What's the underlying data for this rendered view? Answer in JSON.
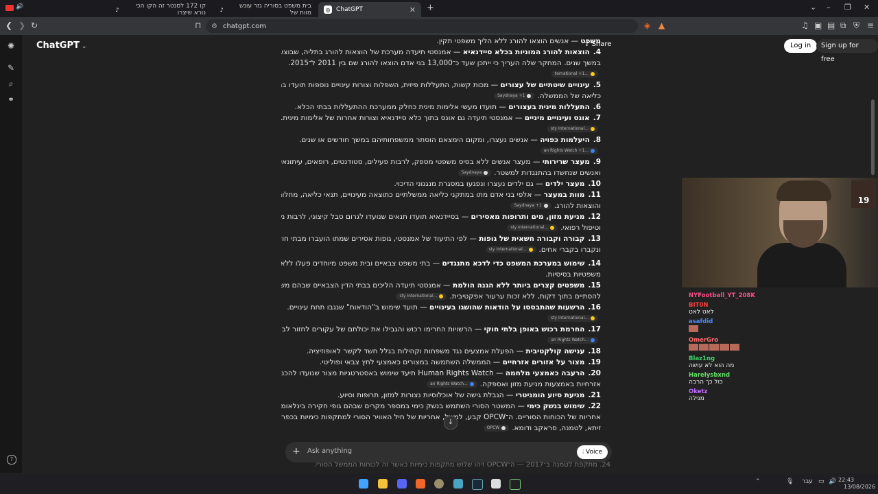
{
  "browser": {
    "tabs": [
      {
        "label": "קו 172 לסנטר זה הקו הכי נורא שיצרו",
        "favicon": "tiktok-icon"
      },
      {
        "label": "בית משפט בסוריה גזר עונש מוות של",
        "favicon": "tiktok-icon"
      },
      {
        "label": "ChatGPT",
        "favicon": "chatgpt-icon",
        "active": true
      }
    ],
    "url": "chatgpt.com"
  },
  "header": {
    "brand": "ChatGPT",
    "share": "Share",
    "login": "Log in",
    "signup": "Sign up for free"
  },
  "content": {
    "lines": [
      {
        "num": "",
        "bold": "משפט",
        "text": " — אנשים הוצאו להורג ללא הליך משפטי תקין.",
        "cite": ""
      },
      {
        "num": "4.",
        "bold": "הוצאות להורג המוניות בכלא סיידנאיא",
        "text": " — אמנסטי תיעדה מערכת של הוצאות להורג בתליה, שבוצעו בסתר",
        "cite": ""
      },
      {
        "num": "",
        "bold": "",
        "text": "במשך שנים. המחקר שלה העריך כי ייתכן שעד כ־13,000 בני אדם הוצאו להורג שם בין 2011 ל־2015.",
        "cite": ""
      },
      {
        "num": "",
        "bold": "",
        "text": "",
        "cite": "...ternational +1"
      },
      {
        "num": "5.",
        "bold": "עינויים שיטתיים של עצורים",
        "text": " — מכות קשות, התעללות פיזית, השפלות וצורות עינויים נוספות תועדו במתקני",
        "cite": ""
      },
      {
        "num": "",
        "bold": "",
        "text": "כליאה של הממשלה.",
        "cite": "Saydnaya +1"
      },
      {
        "num": "6.",
        "bold": "התעללות מינית בעצורים",
        "text": " — תועדו מעשי אלימות מינית כחלק ממערכת ההתעללות בבתי הכלא.",
        "cite": ""
      },
      {
        "num": "7.",
        "bold": "אונס ועינויים מיניים",
        "text": " — אמנסטי תיעדה גם אונס בתוך כלא סיידנאיא וצורות אחרות של אלימות מינית.",
        "cite": ""
      },
      {
        "num": "",
        "bold": "",
        "text": "",
        "cite": "...sty International"
      },
      {
        "num": "8.",
        "bold": "היעלמות כפויה",
        "text": " — אנשים נעצרו, ומקום הימצאם הוסתר ממשפחותיהם במשך חודשים או שנים.",
        "cite": ""
      },
      {
        "num": "",
        "bold": "",
        "text": "",
        "cite": "...an Rights Watch +1"
      },
      {
        "num": "9.",
        "bold": "מעצר שרירותי",
        "text": " — מעצר אנשים ללא בסיס משפטי מספק, לרבות פעילים, סטודנטים, רופאים, עיתונאים",
        "cite": ""
      },
      {
        "num": "",
        "bold": "",
        "text": "ואנשים שנחשדו בהתנגדות למשטר.",
        "cite": "Saydnaya"
      },
      {
        "num": "10.",
        "bold": "מעצר ילדים",
        "text": " — גם ילדים נעצרו ונפגעו במסגרת מנגנוני הדיכוי.",
        "cite": ""
      },
      {
        "num": "11.",
        "bold": "מוות במעצר",
        "text": " — אלפי בני אדם מתו במתקני כליאה ממשלתיים כתוצאה מעינויים, תנאי כליאה, מחלות, רעב",
        "cite": ""
      },
      {
        "num": "",
        "bold": "",
        "text": "והוצאות להורג.",
        "cite": "Saydnaya +1"
      },
      {
        "num": "12.",
        "bold": "מניעת מזון, מים ותרופות מאסירים",
        "text": " — בסיידנאיא תועדו תנאים שנועדו לגרום סבל קיצוני, לרבות מניעת מזון",
        "cite": ""
      },
      {
        "num": "",
        "bold": "",
        "text": "וטיפול רפואי.",
        "cite": "...sty International"
      },
      {
        "num": "13.",
        "bold": "קבורה וקבורה חשאית של גופות",
        "text": " — לפי התיעוד של אמנסטי, גופות אסירים שמתו הועברו מבתי חולים צבאיים",
        "cite": ""
      },
      {
        "num": "",
        "bold": "",
        "text": "ונקברו בקברי אחים.",
        "cite": "...sty International"
      },
      {
        "num": "14.",
        "bold": "שימוש במערכת המשפט כדי לדכא מתנגדים",
        "text": " — בתי משפט צבאיים ובית משפט מיוחדים פעלו ללא ערבויות",
        "cite": ""
      },
      {
        "num": "",
        "bold": "",
        "text": "משפטיות בסיסיות.",
        "cite": ""
      },
      {
        "num": "15.",
        "bold": "משפטים קצרים ביותר ללא הגנה הולמת",
        "text": " — אמנסטי תיעדה הליכים בבתי הדין הצבאיים שבהם משפטים יכלו",
        "cite": ""
      },
      {
        "num": "",
        "bold": "",
        "text": "להסתיים בתוך דקות, ללא זכות ערעור אפקטיבית.",
        "cite": "...sty International"
      },
      {
        "num": "16.",
        "bold": "הרשעות שהתבססו על הודאות שהושגו בעינויים",
        "text": " — תועד שימוש ב\"הודאות\" שנגבו תחת עינויים.",
        "cite": ""
      },
      {
        "num": "",
        "bold": "",
        "text": "",
        "cite": "...sty International"
      },
      {
        "num": "17.",
        "bold": "החרמת רכוש באופן בלתי חוקי",
        "text": " — הרשויות החרימו רכוש והגבילו את יכולתם של עקורים לחזור לבתיהם.",
        "cite": ""
      },
      {
        "num": "",
        "bold": "",
        "text": "",
        "cite": "...an Rights Watch"
      },
      {
        "num": "18.",
        "bold": "ענישה קולקטיבית",
        "text": " — הפעלת אמצעים נגד משפחות וקהילות בגלל חשד לקשר לאופוזיציה.",
        "cite": ""
      },
      {
        "num": "19.",
        "bold": "מצור על אזורים אזרחיים",
        "text": " — הממשלה השתמשה במצורים כאמצעי לחץ צבאי ופוליטי.",
        "cite": ""
      },
      {
        "num": "20.",
        "bold": "הרעבה כאמצעי מלחמה",
        "text": " — Human Rights Watch תיעד שימוש באסטרטגיות מצור שנועדו להכניע אוכלוסיות",
        "cite": ""
      },
      {
        "num": "",
        "bold": "",
        "text": "אזרחיות באמצעות מניעת מזון ואספקה.",
        "cite": "...an Rights Watch"
      },
      {
        "num": "21.",
        "bold": "מניעת סיוע הומניטרי",
        "text": " — הגבלת גישה של אוכלוסיות נצורות למזון, תרופות וסיוע.",
        "cite": ""
      },
      {
        "num": "22.",
        "bold": "שימוש בנשק כימי",
        "text": " — המשטר הסורי השתמש בנשק כימי במספר מקרים שבהם גופי חקירה בינלאומיים קבעו",
        "cite": ""
      },
      {
        "num": "",
        "bold": "",
        "text": "אחריות של הכוחות הסוריים. ה־OPCW קבע, למשל, אחריות של חיל האוויר הסורי למתקפות כימיות בכפר",
        "cite": ""
      },
      {
        "num": "",
        "bold": "",
        "text": "זיתא, לטמנה, סראקב ודומא.",
        "cite": "OPCW"
      }
    ],
    "under_composer": "24. מתקפת לטמנה ב־2017 — ה־OPCW זיהו שלוש מתקפות כימיות כאשר זה לכוחות הממשל הסורי."
  },
  "composer": {
    "placeholder": "Ask anything",
    "voice": "Voice"
  },
  "stream": {
    "badge": "19",
    "chat": [
      {
        "user": "NYFootball_YT_208K",
        "color": "#ff4f8a",
        "text": ""
      },
      {
        "user": "BIT0N",
        "color": "#ff3f3f",
        "text": "לאט לאט"
      },
      {
        "user": "asafdid",
        "color": "#4f8bff",
        "text": ""
      },
      {
        "user": "OmerGro",
        "color": "#ff6b6b",
        "text": ""
      },
      {
        "user": "Blaz1ng",
        "color": "#3fd66b",
        "text": "מה הוא לא עושה"
      },
      {
        "user": "Harelysbxnd",
        "color": "#66e066",
        "text": "כול כך הרבה"
      },
      {
        "user": "Oketz",
        "color": "#c06bff",
        "text": "מגילה"
      }
    ]
  },
  "taskbar": {
    "lang": "עבר",
    "time": "22:43",
    "date": "13/08/2026"
  }
}
